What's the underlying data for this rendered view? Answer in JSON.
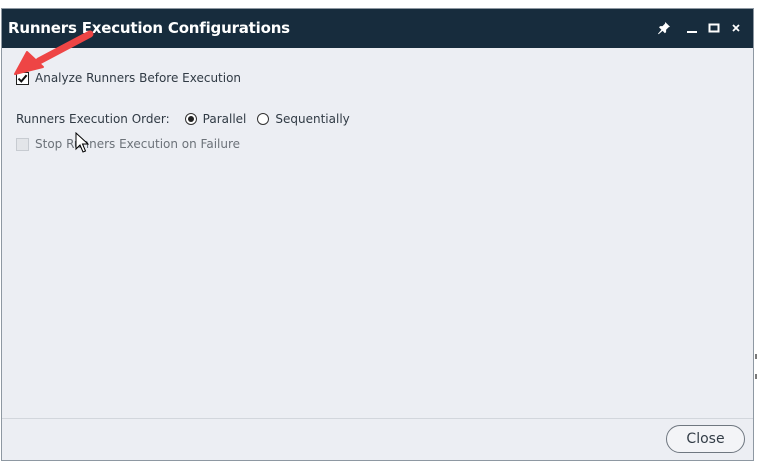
{
  "window": {
    "title": "Runners Execution Configurations",
    "controls": [
      "pin-icon",
      "minimize-icon",
      "maximize-icon",
      "close-icon"
    ]
  },
  "options": {
    "analyze": {
      "label": "Analyze Runners Before Execution",
      "checked": true
    },
    "order": {
      "label": "Runners Execution Order:",
      "selected": "Parallel",
      "choices": [
        "Parallel",
        "Sequentially"
      ]
    },
    "stop_on_failure": {
      "label": "Stop Runners Execution on Failure",
      "checked": false,
      "enabled": false
    }
  },
  "footer": {
    "close_label": "Close"
  },
  "colors": {
    "titlebar": "#172c3d",
    "body": "#eceef3",
    "annotation_arrow": "#ee4545"
  }
}
